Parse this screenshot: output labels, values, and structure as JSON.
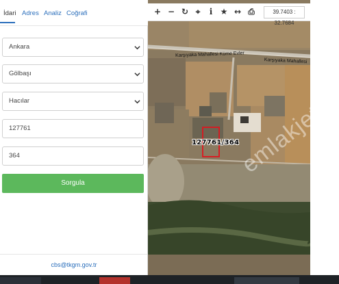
{
  "tabs": [
    {
      "label": "İdari",
      "active": true
    },
    {
      "label": "Adres",
      "active": false
    },
    {
      "label": "Analiz",
      "active": false
    },
    {
      "label": "Coğrafi",
      "active": false
    }
  ],
  "form": {
    "province": "Ankara",
    "district": "Gölbaşı",
    "neighborhood": "Hacılar",
    "block_no": "127761",
    "parcel_no": "364",
    "submit_label": "Sorgula"
  },
  "footer": {
    "email": "cbs@tkgm.gov.tr"
  },
  "map": {
    "coordinates": "39.7403 : 32.7684",
    "parcel_label": "127761/364",
    "road_label_1": "Karşıyaka Mahallesi Küme Evler",
    "road_label_2": "Karşıyaka Mahallesi",
    "watermark": "emlakjet.com",
    "toolbar_icons": [
      "zoom-in-icon",
      "zoom-out-icon",
      "refresh-icon",
      "crosshair-icon",
      "info-icon",
      "star-icon",
      "measure-icon",
      "print-icon"
    ]
  },
  "colors": {
    "accent": "#2a6ebb",
    "button": "#5cb85c",
    "parcel_outline": "#e0141e"
  }
}
